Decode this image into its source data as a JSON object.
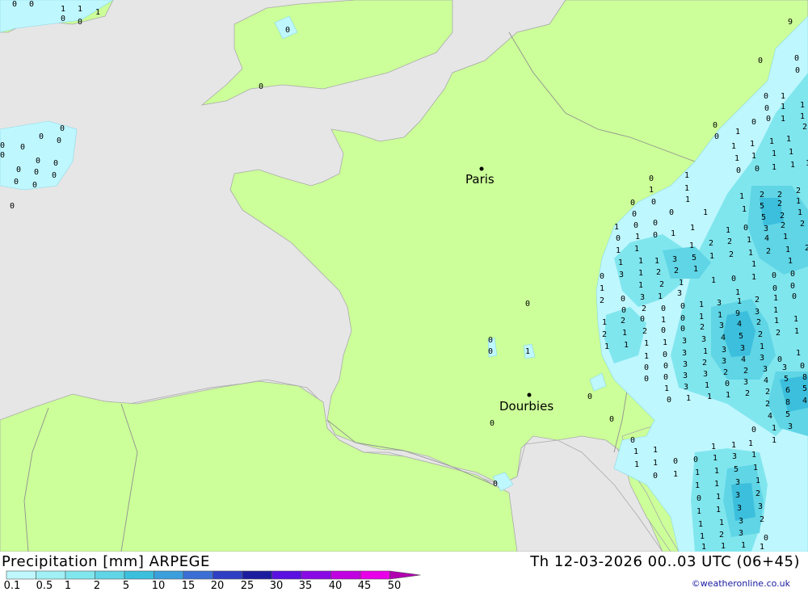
{
  "map": {
    "cities": [
      {
        "name": "Paris"
      },
      {
        "name": "Dourbies"
      }
    ]
  },
  "footer": {
    "title": "Precipitation [mm] ARPEGE",
    "time": "Th 12-03-2026 00..03 UTC (06+45)",
    "credit": "©weatheronline.co.uk"
  },
  "legend": {
    "labels": [
      "0.1",
      "0.5",
      "1",
      "2",
      "5",
      "10",
      "15",
      "20",
      "25",
      "30",
      "35",
      "40",
      "45",
      "50"
    ],
    "colors": [
      "#bff7ff",
      "#a0f0f5",
      "#80e6ee",
      "#5fd5e5",
      "#3cbfdd",
      "#3a9fdc",
      "#3b6fd6",
      "#2e3fc4",
      "#1c1c9e",
      "#5a10e0",
      "#8a0ae6",
      "#c000e0",
      "#e800e8",
      "#b000b0"
    ]
  },
  "colors": {
    "sea": "#e6e6e6",
    "land": "#ccff99",
    "border": "#888888"
  }
}
